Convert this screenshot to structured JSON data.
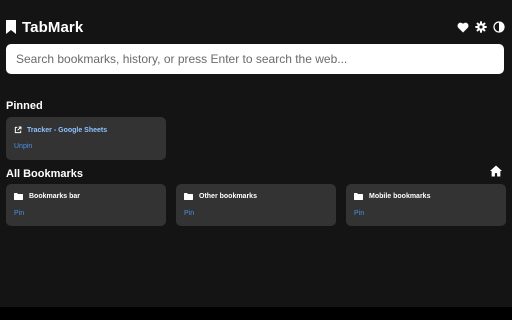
{
  "app": {
    "title": "TabMark"
  },
  "header": {
    "icons": [
      "heart-icon",
      "gear-icon",
      "contrast-icon"
    ]
  },
  "search": {
    "value": "",
    "placeholder": "Search bookmarks, history, or press Enter to search the web..."
  },
  "pinned": {
    "title": "Pinned",
    "items": [
      {
        "label": "Tracker - Google Sheets",
        "action": "Unpin",
        "icon": "external-link-icon"
      }
    ]
  },
  "all_bookmarks": {
    "title": "All Bookmarks",
    "home_icon": "home-icon",
    "folders": [
      {
        "label": "Bookmarks bar",
        "action": "Pin",
        "icon": "folder-icon"
      },
      {
        "label": "Other bookmarks",
        "action": "Pin",
        "icon": "folder-icon"
      },
      {
        "label": "Mobile bookmarks",
        "action": "Pin",
        "icon": "folder-icon"
      }
    ]
  },
  "colors": {
    "background": "#141414",
    "card": "#333333",
    "accent_link": "#4a90e2",
    "pinned_title": "#8ec2ff"
  }
}
